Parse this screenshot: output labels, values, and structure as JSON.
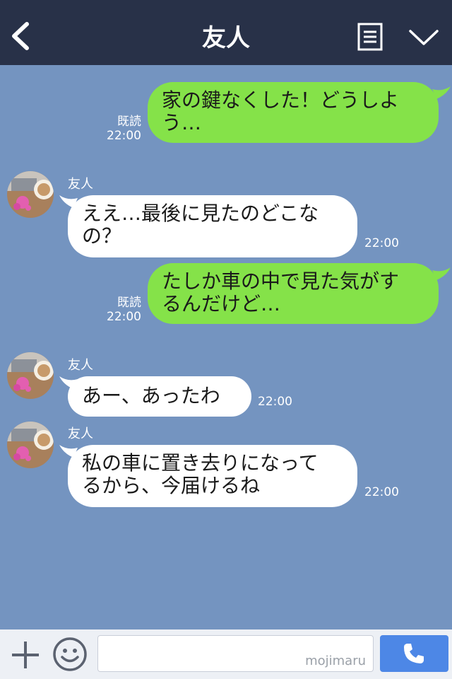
{
  "header": {
    "title": "友人",
    "back_icon": "chevron-left-icon",
    "menu_icon": "list-icon",
    "collapse_icon": "chevron-down-icon"
  },
  "messages": [
    {
      "direction": "out",
      "text_lines": [
        "家の鍵なくした！どうしよ",
        "う…"
      ],
      "read_label": "既読",
      "time": "22:00"
    },
    {
      "direction": "in",
      "sender": "友人",
      "text_lines": [
        "ええ…最後に見たのどこな",
        "の？"
      ],
      "time": "22:00"
    },
    {
      "direction": "out",
      "text_lines": [
        "たしか車の中で見た気がす",
        "るんだけど…"
      ],
      "read_label": "既読",
      "time": "22:00"
    },
    {
      "direction": "in",
      "sender": "友人",
      "text_lines": [
        "あー、あったわ"
      ],
      "time": "22:00"
    },
    {
      "direction": "in",
      "sender": "友人",
      "text_lines": [
        "私の車に置き去りになって",
        "るから、今届けるね"
      ],
      "time": "22:00"
    }
  ],
  "footer": {
    "input_value": "",
    "watermark": "mojimaru",
    "plus_icon": "plus-icon",
    "emoji_icon": "smiley-icon",
    "call_icon": "phone-icon"
  },
  "colors": {
    "header_bg": "#283148",
    "chat_bg": "#7494c0",
    "outgoing_bubble": "#85e249",
    "incoming_bubble": "#ffffff",
    "call_button": "#4d87e6"
  }
}
